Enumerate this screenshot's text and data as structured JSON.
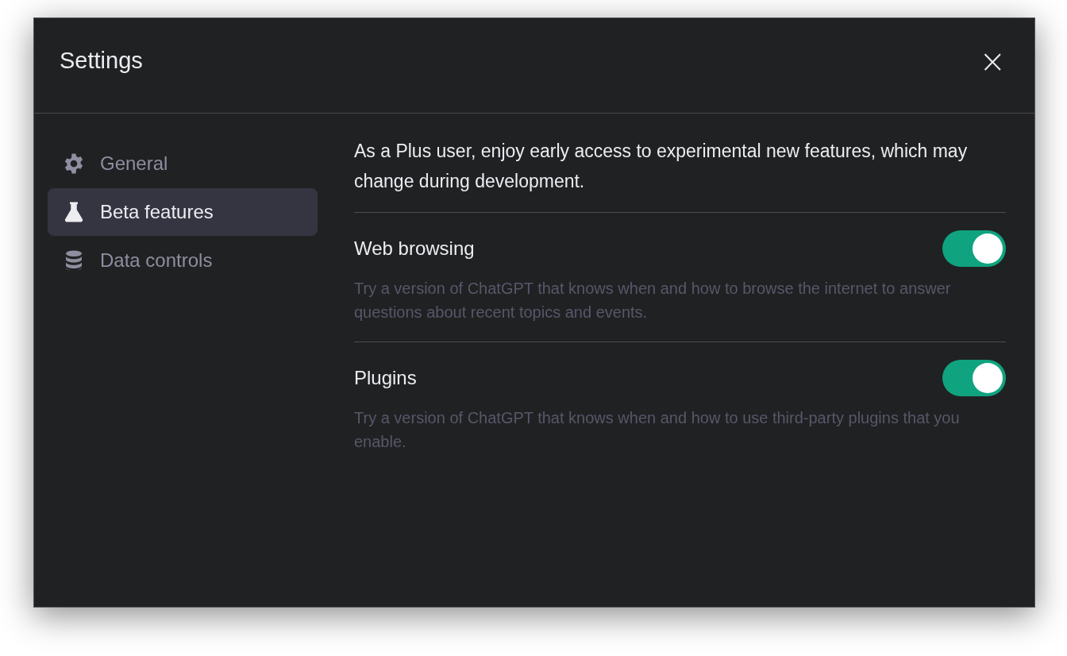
{
  "dialog": {
    "title": "Settings",
    "close": "×"
  },
  "sidebar": {
    "items": [
      {
        "label": "General",
        "kind": "gear",
        "selected": false
      },
      {
        "label": "Beta features",
        "kind": "flask",
        "selected": true
      },
      {
        "label": "Data controls",
        "kind": "database",
        "selected": false
      }
    ]
  },
  "intro": "As a Plus user, enjoy early access to experimental new features, which may change during development.",
  "features": [
    {
      "label": "Web browsing",
      "on": true,
      "description": "Try a version of ChatGPT that knows when and how to browse the internet to answer questions about recent topics and events."
    },
    {
      "label": "Plugins",
      "on": true,
      "description": "Try a version of ChatGPT that knows when and how to use third-party plugins that you enable."
    }
  ]
}
